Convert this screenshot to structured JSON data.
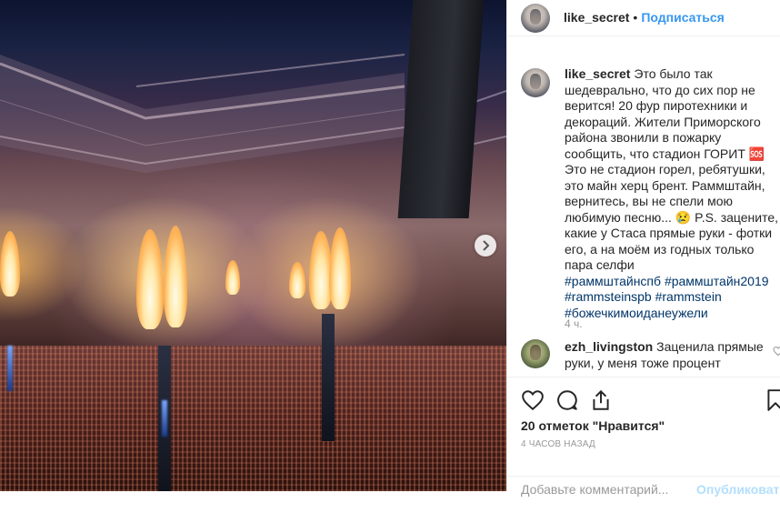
{
  "header": {
    "username": "like_secret",
    "separator": "•",
    "follow_label": "Подписаться"
  },
  "caption": {
    "username": "like_secret",
    "text": "Это было так шедеврально, что до сих пор не верится! 20 фур пиротехники и декораций. Жители Приморского района звонили в пожарку сообщить, что стадион ГОРИТ 🆘 Это не стадион горел, ребятушки, это майн херц брент. Раммштайн, вернитесь, вы не спели мою любимую песню... 😢 P.S. зацените, какие у Стаса прямые руки - фотки его, а на моём из годных только пара селфи",
    "hashtags": [
      "#раммштайнспб",
      "#раммштайн2019",
      "#rammsteinspb",
      "#rammstein",
      "#божечкимоиданеужели"
    ],
    "time": "4 ч."
  },
  "comment": {
    "username": "ezh_livingston",
    "text": "Заценила прямые руки, у меня тоже процент"
  },
  "actions": {
    "likes": "20 отметок \"Нравится\"",
    "posted": "4 ЧАСОВ НАЗАД"
  },
  "add_comment": {
    "placeholder": "Добавьте комментарий...",
    "publish_label": "Опубликовать"
  },
  "icons": {
    "like": "heart-icon",
    "comment": "comment-icon",
    "share": "share-icon",
    "save": "bookmark-icon",
    "next": "chevron-right-icon"
  },
  "colors": {
    "link": "#3897f0",
    "hashtag": "#003569",
    "muted": "#999999",
    "text": "#262626"
  }
}
